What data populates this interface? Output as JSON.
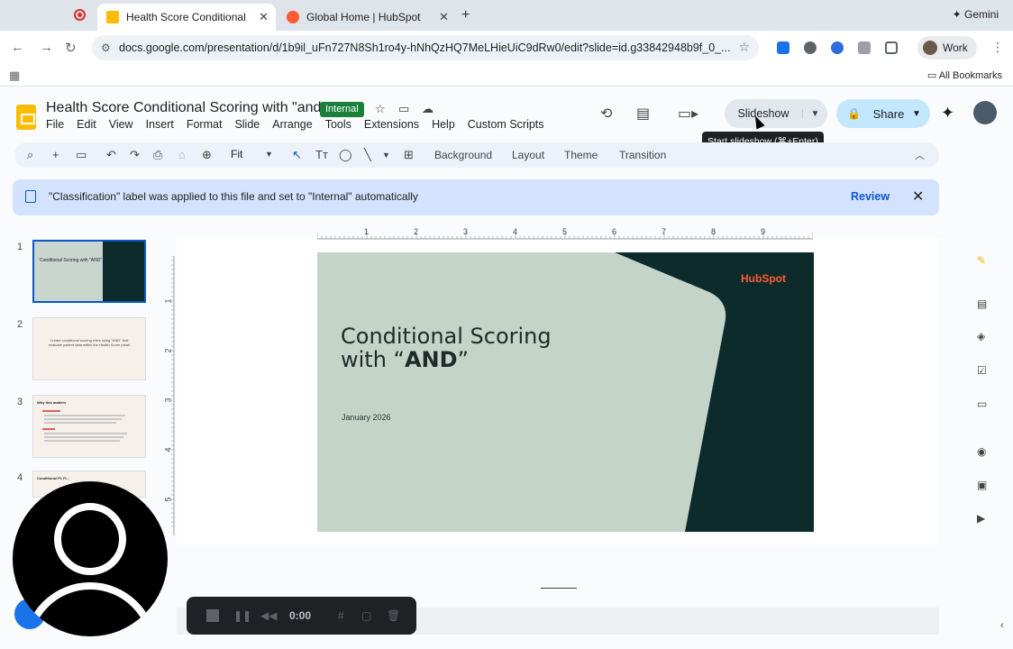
{
  "browser": {
    "tabs": [
      {
        "title": "Health Score Conditional Sco",
        "active": true
      },
      {
        "title": "Global Home | HubSpot",
        "active": false
      }
    ],
    "new_tab": "+",
    "profile_label": "Gemini",
    "url": "docs.google.com/presentation/d/1b9il_uFn727N8Sh1ro4y-hNhQzHQ7MeLHieUiC9dRw0/edit?slide=id.g33842948b9f_0_...",
    "work_label": "Work",
    "all_bookmarks": "All Bookmarks"
  },
  "header": {
    "title": "Health Score Conditional Scoring with \"and\"",
    "badge": "Internal",
    "menu": [
      "File",
      "Edit",
      "View",
      "Insert",
      "Format",
      "Slide",
      "Arrange",
      "Tools",
      "Extensions",
      "Help",
      "Custom Scripts"
    ],
    "slideshow_label": "Slideshow",
    "share_label": "Share",
    "tooltip": "Start slideshow (⌘+Enter)"
  },
  "toolbar": {
    "zoom": "Fit",
    "background_label": "Background",
    "layout_label": "Layout",
    "theme_label": "Theme",
    "transition_label": "Transition"
  },
  "banner": {
    "text": "\"Classification\" label was applied to this file and set to \"Internal\" automatically",
    "review_label": "Review"
  },
  "filmstrip": {
    "numbers": [
      "1",
      "2",
      "3",
      "4"
    ],
    "thumb1_title": "Conditional Scoring with \"AND\"",
    "thumb2_text": "Create conditional scoring rules using \"AND\" that evaluate patient data within the Health Score panel",
    "thumb3_title": "Why this matters",
    "thumb4_title": "Conditional P1 Fi..."
  },
  "ruler": {
    "h_ticks": [
      "1",
      "2",
      "3",
      "4",
      "5",
      "6",
      "7",
      "8",
      "9"
    ],
    "v_ticks": [
      "1",
      "2",
      "3",
      "4",
      "5"
    ]
  },
  "slide": {
    "title_line1": "Conditional Scoring",
    "title_line2_prefix": "with “",
    "title_bold": "AND",
    "title_line2_suffix": "”",
    "date": "January 2026",
    "logo": "HubSpot"
  },
  "recorder": {
    "time": "0:00"
  },
  "colors": {
    "slide_bg": "#c5d4c9",
    "slide_dark": "#0d2b2b",
    "hubspot_orange": "#ff5c35",
    "internal_badge": "#188038",
    "accent_blue": "#0b57d0"
  }
}
